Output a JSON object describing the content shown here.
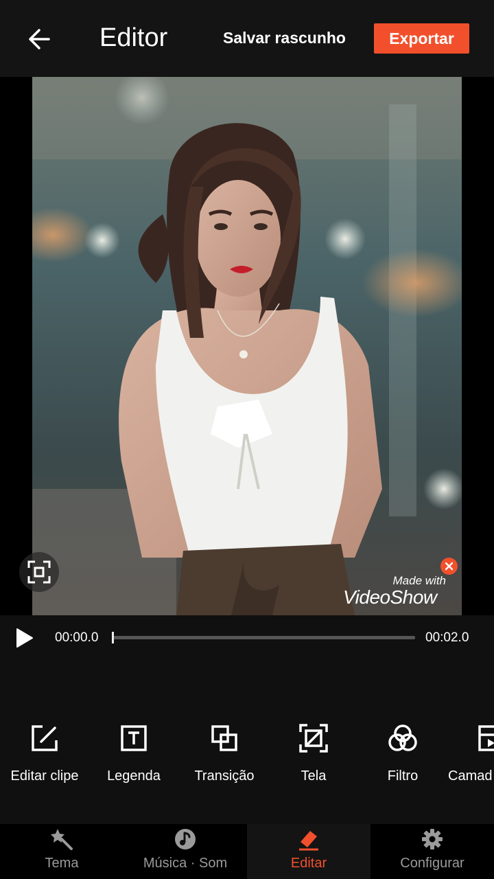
{
  "header": {
    "title": "Editor",
    "save_draft_label": "Salvar rascunho",
    "export_label": "Exportar"
  },
  "preview": {
    "watermark_small": "Made with",
    "watermark_brand": "VideoShow"
  },
  "playback": {
    "current_time": "00:00.0",
    "total_time": "00:02.0",
    "progress": 0.0
  },
  "tools": [
    {
      "label": "Editar clipe",
      "icon": "edit-clip-icon"
    },
    {
      "label": "Legenda",
      "icon": "text-icon"
    },
    {
      "label": "Transição",
      "icon": "transition-icon"
    },
    {
      "label": "Tela",
      "icon": "crop-icon"
    },
    {
      "label": "Filtro",
      "icon": "filter-icon"
    },
    {
      "label": "Camad",
      "icon": "layer-icon"
    }
  ],
  "nav": [
    {
      "label": "Tema",
      "icon": "theme-wand-icon",
      "active": false
    },
    {
      "label": "Música · Som",
      "icon": "music-note-icon",
      "active": false
    },
    {
      "label": "Editar",
      "icon": "eraser-edit-icon",
      "active": true
    },
    {
      "label": "Configurar",
      "icon": "gear-icon",
      "active": false
    }
  ],
  "colors": {
    "accent": "#f2502c",
    "background": "#101010",
    "header": "#141414"
  }
}
